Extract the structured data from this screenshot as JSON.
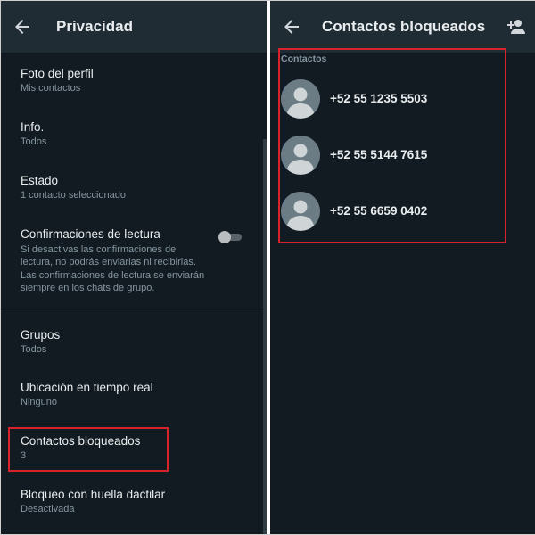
{
  "left_panel": {
    "title": "Privacidad",
    "settings": [
      {
        "title": "Foto del perfil",
        "subtitle": "Mis contactos"
      },
      {
        "title": "Info.",
        "subtitle": "Todos"
      },
      {
        "title": "Estado",
        "subtitle": "1 contacto seleccionado"
      },
      {
        "title": "Confirmaciones de lectura",
        "description_lines": [
          "Si desactivas las confirmaciones de",
          "lectura, no podrás enviarlas ni recibirlas.",
          "Las confirmaciones de lectura se enviarán",
          "siempre en los chats de grupo."
        ],
        "toggle_on": false
      },
      {
        "title": "Grupos",
        "subtitle": "Todos"
      },
      {
        "title": "Ubicación en tiempo real",
        "subtitle": "Ninguno"
      },
      {
        "title": "Contactos bloqueados",
        "subtitle": "3"
      },
      {
        "title": "Bloqueo con huella dactilar",
        "subtitle": "Desactivada"
      }
    ]
  },
  "right_panel": {
    "title": "Contactos bloqueados",
    "section_label": "Contactos",
    "contacts": [
      {
        "name": "+52 55 1235 5503"
      },
      {
        "name": "+52 55 5144 7615"
      },
      {
        "name": "+52 55 6659 0402"
      }
    ]
  },
  "icons": {
    "back": "arrow-left-icon",
    "add_contact": "person-add-icon",
    "avatar": "default-avatar-icon"
  },
  "colors": {
    "background": "#121b22",
    "appbar": "#1f2c34",
    "primary_text": "#e9edef",
    "secondary_text": "#8696a0",
    "highlight": "#d9232b"
  }
}
